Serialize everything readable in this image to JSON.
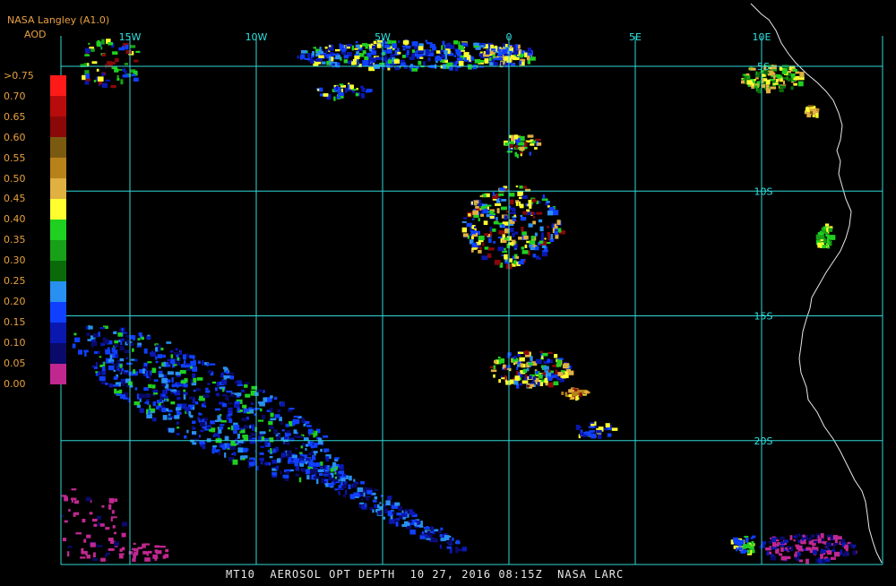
{
  "header": {
    "title": "NASA Langley (A1.0)",
    "subtitle": "AOD"
  },
  "legend": {
    "labels": [
      ">0.75",
      "0.70",
      "0.65",
      "0.60",
      "0.55",
      "0.50",
      "0.45",
      "0.40",
      "0.35",
      "0.30",
      "0.25",
      "0.20",
      "0.15",
      "0.10",
      "0.05",
      "0.00"
    ],
    "colors": [
      "#ff1a1a",
      "#b80c0c",
      "#8a0808",
      "#7a5a10",
      "#b8821a",
      "#e0b040",
      "#ffff30",
      "#20d020",
      "#18a018",
      "#0a6a0a",
      "#2890f0",
      "#1040ff",
      "#0a18b0",
      "#0a0a6a",
      "#c02890"
    ]
  },
  "grid": {
    "lon_labels": [
      "15W",
      "10W",
      "5W",
      "0",
      "5E",
      "10E"
    ],
    "lat_labels": [
      "5S",
      "10S",
      "15S",
      "20S"
    ],
    "lon_values": [
      -15,
      -10,
      -5,
      0,
      5,
      10
    ],
    "lat_values": [
      -5,
      -10,
      -15,
      -20
    ],
    "color": "#30d8d8"
  },
  "footer": {
    "product": "MT10",
    "parameter": "AEROSOL OPT DEPTH",
    "datetime": "10 27, 2016 08:15Z",
    "source": "NASA LARC"
  }
}
